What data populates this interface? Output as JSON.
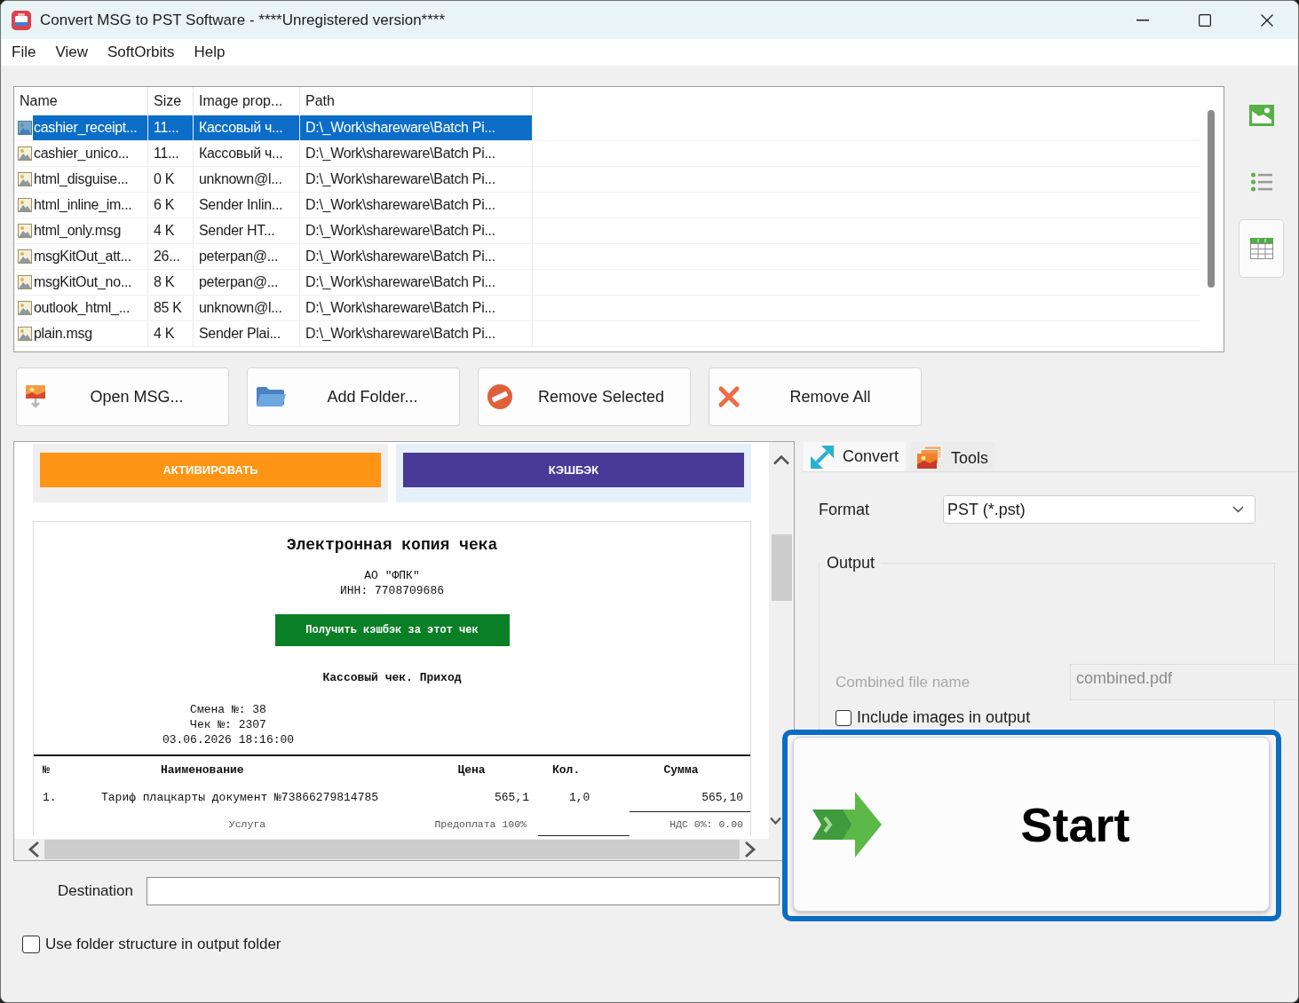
{
  "window": {
    "title": "Convert MSG to PST Software - ****Unregistered version****"
  },
  "menu": [
    {
      "label": "File"
    },
    {
      "label": "View"
    },
    {
      "label": "SoftOrbits"
    },
    {
      "label": "Help"
    }
  ],
  "file_table": {
    "columns": [
      "Name",
      "Size",
      "Image prop...",
      "Path"
    ],
    "rows": [
      {
        "cells": [
          "cashier_receipt...",
          "11...",
          "Кассовый ч...",
          "D:\\_Work\\shareware\\Batch Pi..."
        ],
        "selected": true
      },
      {
        "cells": [
          "cashier_unico...",
          "11...",
          "Кассовый ч...",
          "D:\\_Work\\shareware\\Batch Pi..."
        ],
        "selected": false
      },
      {
        "cells": [
          "html_disguise...",
          "0 K",
          "unknown@l...",
          "D:\\_Work\\shareware\\Batch Pi..."
        ],
        "selected": false
      },
      {
        "cells": [
          "html_inline_im...",
          "6 K",
          "Sender Inlin...",
          "D:\\_Work\\shareware\\Batch Pi..."
        ],
        "selected": false
      },
      {
        "cells": [
          "html_only.msg",
          "4 K",
          "Sender HT...",
          "D:\\_Work\\shareware\\Batch Pi..."
        ],
        "selected": false
      },
      {
        "cells": [
          "msgKitOut_att...",
          "26...",
          "peterpan@...",
          "D:\\_Work\\shareware\\Batch Pi..."
        ],
        "selected": false
      },
      {
        "cells": [
          "msgKitOut_no...",
          "8 K",
          "peterpan@...",
          "D:\\_Work\\shareware\\Batch Pi..."
        ],
        "selected": false
      },
      {
        "cells": [
          "outlook_html_...",
          "85 K",
          "unknown@l...",
          "D:\\_Work\\shareware\\Batch Pi..."
        ],
        "selected": false
      },
      {
        "cells": [
          "plain.msg",
          "4 K",
          "Sender Plai...",
          "D:\\_Work\\shareware\\Batch Pi..."
        ],
        "selected": false
      }
    ]
  },
  "view_buttons": [
    {
      "kind": "thumbnails",
      "selected": false
    },
    {
      "kind": "list",
      "selected": false
    },
    {
      "kind": "details",
      "selected": true
    }
  ],
  "action_buttons": [
    {
      "kind": "open",
      "label": "Open MSG..."
    },
    {
      "kind": "add_folder",
      "label": "Add Folder..."
    },
    {
      "kind": "remove_selected",
      "label": "Remove Selected"
    },
    {
      "kind": "remove_all",
      "label": "Remove All"
    }
  ],
  "preview": {
    "banner_buttons": [
      {
        "label": "АКТИВИРОВАТЬ",
        "color": "#ff9514"
      },
      {
        "label": "КЭШБЭК",
        "color": "#483a96"
      }
    ],
    "receipt": {
      "title": "Электронная копия чека",
      "company": "АО \"ФПК\"",
      "tax_id": "ИНН: 7708709686",
      "cashback_button": "Получить кэшбэк за этот чек",
      "receipt_type": "Кассовый чек. Приход",
      "details": [
        "Смена №: 38",
        "Чек №: 2307",
        "03.06.2026 18:16:00"
      ],
      "columns": [
        "№",
        "Наименование",
        "Цена",
        "Кол.",
        "Сумма"
      ],
      "items": [
        {
          "cells": [
            "1.",
            "Тариф плацкарты документ №73866279814785",
            "565,1",
            "1,0",
            "565,10"
          ],
          "notes": [
            "Услуга",
            "Предоплата 100%",
            "НДС 0%: 0.00"
          ]
        }
      ]
    }
  },
  "tabs": [
    {
      "kind": "convert",
      "label": "Convert",
      "selected": true
    },
    {
      "kind": "tools",
      "label": "Tools",
      "selected": false
    }
  ],
  "format": {
    "label": "Format",
    "value": "PST (*.pst)"
  },
  "output": {
    "title": "Output",
    "combined_file": {
      "label": "Combined file name",
      "value": "combined.pdf",
      "disabled": true
    },
    "include_images": {
      "label": "Include images in output",
      "checked": false
    }
  },
  "destination": {
    "label": "Destination"
  },
  "folder_structure": {
    "label": "Use folder structure in output folder",
    "checked": false
  },
  "start_button": {
    "label": "Start"
  }
}
